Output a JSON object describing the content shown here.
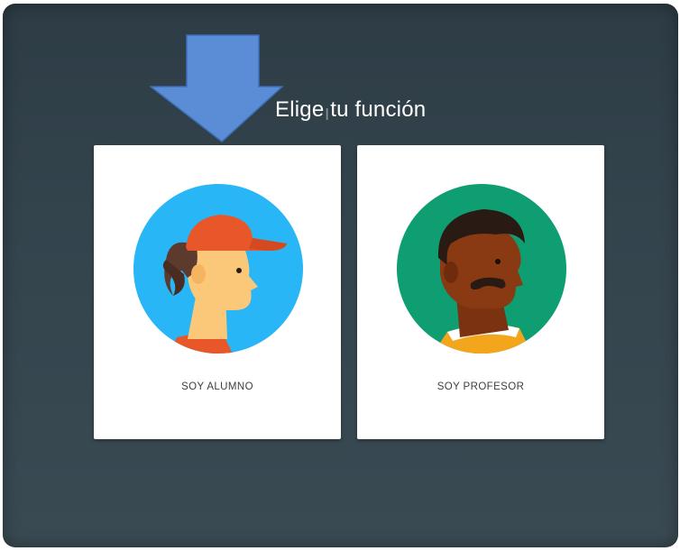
{
  "dialog": {
    "title": "Elige tu función"
  },
  "cards": {
    "student": {
      "label": "SOY ALUMNO"
    },
    "teacher": {
      "label": "SOY PROFESOR"
    }
  },
  "colors": {
    "background": "#34444d",
    "card": "#ffffff",
    "arrow": "#5b8dd6",
    "student_circle": "#29b6f6",
    "student_cap": "#e8572a",
    "teacher_circle": "#0f9d72",
    "teacher_skin": "#8a3a12"
  },
  "icons": {
    "pointer": "arrow-down-icon",
    "cursor": "text-cursor-icon"
  }
}
